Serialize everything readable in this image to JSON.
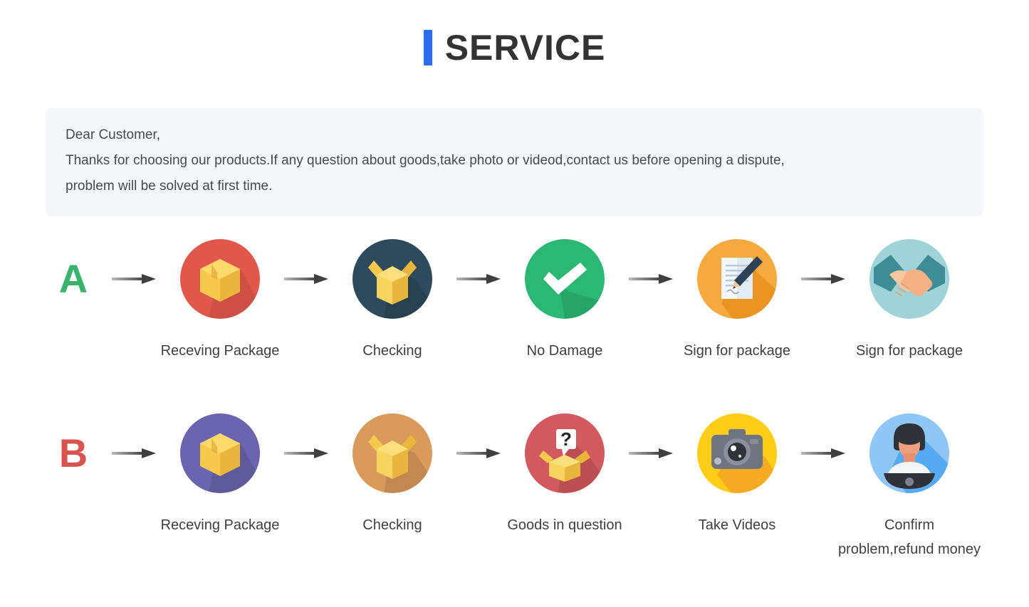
{
  "header": {
    "title": "SERVICE",
    "accent_color": "#2a6df4"
  },
  "notice": {
    "line1": "Dear Customer,",
    "line2": "Thanks for choosing our products.If any question about goods,take photo or videod,contact us before opening a dispute,",
    "line3": "problem will be solved at first time.",
    "background_color": "#f4f6fa"
  },
  "flows": [
    {
      "marker": "A",
      "marker_color": "#39b36a",
      "steps": [
        {
          "label": "Receving Package",
          "icon": "closed-box-icon",
          "circle_color": "#e2574c"
        },
        {
          "label": "Checking",
          "icon": "open-box-icon",
          "circle_color": "#2e4a5c"
        },
        {
          "label": "No Damage",
          "icon": "check-mark-icon",
          "circle_color": "#2cb872"
        },
        {
          "label": "Sign for package",
          "icon": "document-pen-icon",
          "circle_color": "#f5a93f"
        },
        {
          "label": "Sign for package",
          "icon": "handshake-icon",
          "circle_color": "#9fd3d8"
        }
      ]
    },
    {
      "marker": "B",
      "marker_color": "#d9534f",
      "steps": [
        {
          "label": "Receving Package",
          "icon": "closed-box-icon",
          "circle_color": "#6a65ae"
        },
        {
          "label": "Checking",
          "icon": "open-box-icon",
          "circle_color": "#d99a5c"
        },
        {
          "label": "Goods in question",
          "icon": "question-box-icon",
          "circle_color": "#d2595e"
        },
        {
          "label": "Take Videos",
          "icon": "camera-icon",
          "circle_color": "#ffcc17"
        },
        {
          "label": "Confirm  problem,refund money",
          "icon": "person-avatar-icon",
          "circle_color": "#8ec6f5"
        }
      ]
    }
  ],
  "arrow": {
    "name": "right-arrow-icon",
    "color": "#4a4a4a"
  }
}
